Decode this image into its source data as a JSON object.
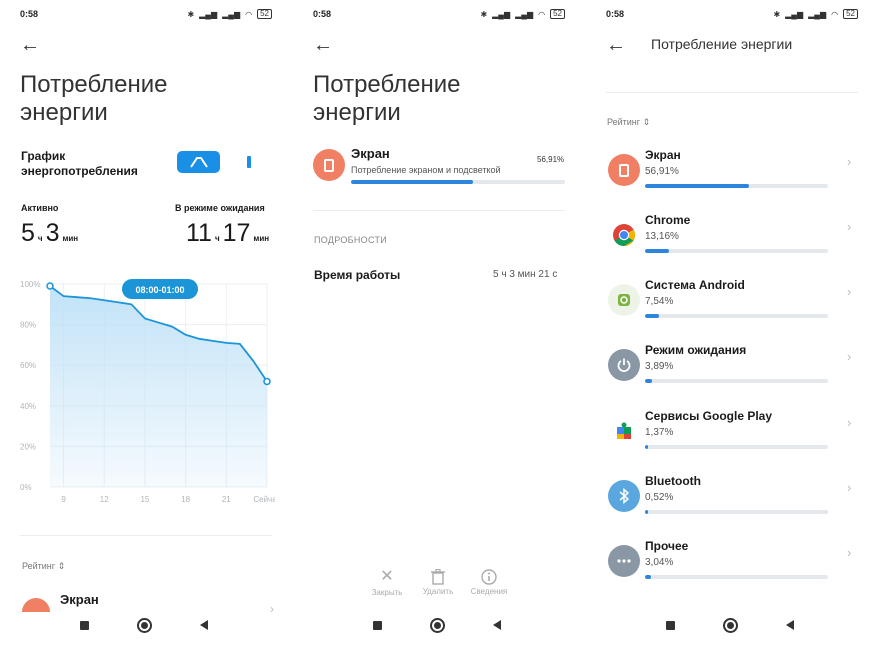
{
  "status": {
    "time": "0:58",
    "battery": "52"
  },
  "phone1": {
    "title": "Потребление энергии",
    "chart_label": "График энергопотребления",
    "active_label": "Активно",
    "active_h": "5",
    "active_m": "3",
    "standby_label": "В режиме ожидания",
    "standby_h": "11",
    "standby_m": "17",
    "unit_h": "ч",
    "unit_m": "мин",
    "tooltip": "08:00-01:00",
    "rating": "Рейтинг",
    "first_item": "Экран"
  },
  "chart_data": {
    "type": "area",
    "title": "",
    "xlabel": "",
    "ylabel": "",
    "ylim": [
      0,
      100
    ],
    "y_ticks": [
      "100%",
      "80%",
      "60%",
      "40%",
      "20%",
      "0%"
    ],
    "x_ticks": [
      "9",
      "12",
      "15",
      "18",
      "21",
      "Сейчас"
    ],
    "x": [
      8,
      9,
      10,
      11,
      12,
      13,
      14,
      15,
      16,
      17,
      18,
      19,
      20,
      21,
      22,
      23,
      24
    ],
    "values": [
      99,
      94,
      93.5,
      93,
      92,
      91,
      90,
      83,
      81,
      79,
      75,
      73,
      72,
      71,
      70.5,
      62,
      52
    ],
    "grid": true,
    "colors": {
      "line": "#1c94d8",
      "fill": "#bfe1f7"
    }
  },
  "phone2": {
    "title": "Потребление энергии",
    "item_name": "Экран",
    "item_sub": "Потребление экраном и подсветкой",
    "item_pct": "56,91%",
    "item_frac": 0.5691,
    "details_caption": "ПОДРОБНОСТИ",
    "runtime_key": "Время работы",
    "runtime_val": "5 ч 3 мин 21 с",
    "actions": [
      {
        "icon": "close-icon",
        "label": "Закрыть"
      },
      {
        "icon": "trash-icon",
        "label": "Удалить"
      },
      {
        "icon": "info-icon",
        "label": "Сведения"
      }
    ]
  },
  "phone3": {
    "title": "Потребление энергии",
    "rating": "Рейтинг",
    "items": [
      {
        "name": "Экран",
        "pct": "56,91%",
        "frac": 0.5691,
        "color": "#f07f64",
        "icon": "screen-icon"
      },
      {
        "name": "Chrome",
        "pct": "13,16%",
        "frac": 0.1316,
        "color": "#ffffff",
        "icon": "chrome-icon"
      },
      {
        "name": "Система Android",
        "pct": "7,54%",
        "frac": 0.0754,
        "color": "#eef3e8",
        "icon": "android-gear-icon"
      },
      {
        "name": "Режим ожидания",
        "pct": "3,89%",
        "frac": 0.0389,
        "color": "#8a98a6",
        "icon": "power-icon"
      },
      {
        "name": "Сервисы Google Play",
        "pct": "1,37%",
        "frac": 0.0137,
        "color": "#ffffff",
        "icon": "puzzle-icon"
      },
      {
        "name": "Bluetooth",
        "pct": "0,52%",
        "frac": 0.0052,
        "color": "#5aa7e0",
        "icon": "bluetooth-icon"
      },
      {
        "name": "Прочее",
        "pct": "3,04%",
        "frac": 0.0304,
        "color": "#8a98a6",
        "icon": "more-icon"
      }
    ]
  }
}
